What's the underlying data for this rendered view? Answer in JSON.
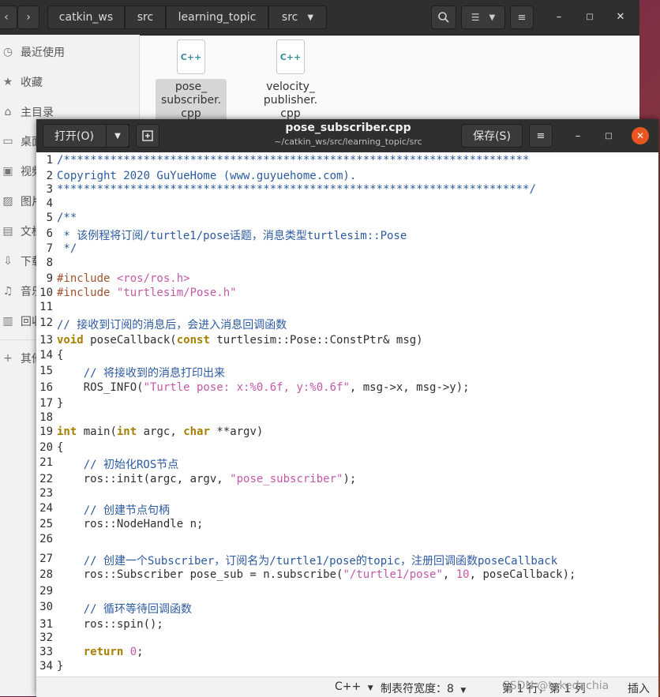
{
  "file_manager": {
    "breadcrumbs": [
      "catkin_ws",
      "src",
      "learning_topic",
      "src"
    ],
    "sidebar": [
      {
        "icon": "clock-icon",
        "label": "最近使用"
      },
      {
        "icon": "star-icon",
        "label": "收藏"
      },
      {
        "icon": "home-icon",
        "label": "主目录"
      },
      {
        "icon": "desktop-icon",
        "label": "桌面"
      },
      {
        "icon": "video-icon",
        "label": "视频"
      },
      {
        "icon": "image-icon",
        "label": "图片"
      },
      {
        "icon": "document-icon",
        "label": "文档"
      },
      {
        "icon": "download-icon",
        "label": "下载"
      },
      {
        "icon": "music-icon",
        "label": "音乐"
      },
      {
        "icon": "trash-icon",
        "label": "回收站"
      },
      {
        "icon": "plus-icon",
        "label": "其他位置"
      }
    ],
    "files": [
      {
        "icon_text": "C++",
        "name_lines": [
          "pose_",
          "subscriber.",
          "cpp"
        ]
      },
      {
        "icon_text": "C++",
        "name_lines": [
          "velocity_",
          "publisher.",
          "cpp"
        ]
      }
    ]
  },
  "editor": {
    "open_label": "打开(O)",
    "save_label": "保存(S)",
    "title": "pose_subscriber.cpp",
    "path": "~/catkin_ws/src/learning_topic/src",
    "code_lines": [
      [
        [
          "cm",
          "/**********************************************************************"
        ]
      ],
      [
        [
          "cm",
          "Copyright 2020 GuYueHome (www.guyuehome.com)."
        ]
      ],
      [
        [
          "cm",
          "***********************************************************************/"
        ]
      ],
      [],
      [
        [
          "cm",
          "/**"
        ]
      ],
      [
        [
          "cm",
          " * 该例程将订阅/turtle1/pose话题，消息类型turtlesim::Pose"
        ]
      ],
      [
        [
          "cm",
          " */"
        ]
      ],
      [],
      [
        [
          "pp",
          "#include "
        ],
        [
          "hdr",
          "<ros/ros.h>"
        ]
      ],
      [
        [
          "pp",
          "#include "
        ],
        [
          "hdr",
          "\"turtlesim/Pose.h\""
        ]
      ],
      [],
      [
        [
          "cm",
          "// 接收到订阅的消息后，会进入消息回调函数"
        ]
      ],
      [
        [
          "kw",
          "void"
        ],
        [
          "tx",
          " poseCallback("
        ],
        [
          "kw",
          "const"
        ],
        [
          "tx",
          " turtlesim::Pose::ConstPtr& msg)"
        ]
      ],
      [
        [
          "tx",
          "{"
        ]
      ],
      [
        [
          "tx",
          "    "
        ],
        [
          "cm",
          "// 将接收到的消息打印出来"
        ]
      ],
      [
        [
          "tx",
          "    ROS_INFO("
        ],
        [
          "st",
          "\"Turtle pose: x:%0.6f, y:%0.6f\""
        ],
        [
          "tx",
          ", msg->x, msg->y);"
        ]
      ],
      [
        [
          "tx",
          "}"
        ]
      ],
      [],
      [
        [
          "kw",
          "int"
        ],
        [
          "tx",
          " main("
        ],
        [
          "kw",
          "int"
        ],
        [
          "tx",
          " argc, "
        ],
        [
          "kw",
          "char"
        ],
        [
          "tx",
          " **argv)"
        ]
      ],
      [
        [
          "tx",
          "{"
        ]
      ],
      [
        [
          "tx",
          "    "
        ],
        [
          "cm",
          "// 初始化ROS节点"
        ]
      ],
      [
        [
          "tx",
          "    ros::init(argc, argv, "
        ],
        [
          "st",
          "\"pose_subscriber\""
        ],
        [
          "tx",
          ");"
        ]
      ],
      [],
      [
        [
          "tx",
          "    "
        ],
        [
          "cm",
          "// 创建节点句柄"
        ]
      ],
      [
        [
          "tx",
          "    ros::NodeHandle n;"
        ]
      ],
      [],
      [
        [
          "tx",
          "    "
        ],
        [
          "cm",
          "// 创建一个Subscriber，订阅名为/turtle1/pose的topic，注册回调函数poseCallback"
        ]
      ],
      [
        [
          "tx",
          "    ros::Subscriber pose_sub = n.subscribe("
        ],
        [
          "st",
          "\"/turtle1/pose\""
        ],
        [
          "tx",
          ", "
        ],
        [
          "nu",
          "10"
        ],
        [
          "tx",
          ", poseCallback);"
        ]
      ],
      [],
      [
        [
          "tx",
          "    "
        ],
        [
          "cm",
          "// 循环等待回调函数"
        ]
      ],
      [
        [
          "tx",
          "    ros::spin();"
        ]
      ],
      [],
      [
        [
          "tx",
          "    "
        ],
        [
          "kw",
          "return"
        ],
        [
          "tx",
          " "
        ],
        [
          "nu",
          "0"
        ],
        [
          "tx",
          ";"
        ]
      ],
      [
        [
          "tx",
          "}"
        ]
      ]
    ],
    "status": {
      "language": "C++",
      "tab_width": "制表符宽度：8",
      "position": "第 1 行，第 1 列",
      "mode": "插入",
      "watermark": "CSDN @takedachia"
    }
  }
}
